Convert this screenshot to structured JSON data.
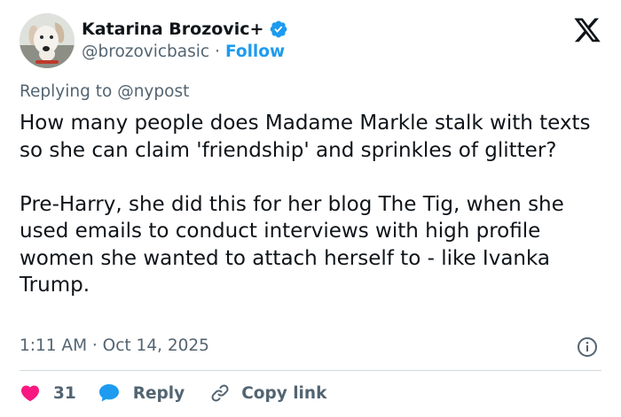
{
  "author": {
    "name": "Katarina Brozovic+",
    "handle": "@brozovicbasic",
    "separator": "·",
    "follow_label": "Follow"
  },
  "reply_context": {
    "prefix": "Replying to",
    "mention": "@nypost"
  },
  "tweet": {
    "text": "How many people does Madame Markle stalk with texts so she can claim 'friendship' and sprinkles of glitter?\n\nPre-Harry, she did this for her blog The Tig, when she used emails to conduct interviews with high profile women she wanted to attach herself to - like Ivanka Trump.",
    "timestamp": "1:11 AM · Oct 14, 2025"
  },
  "actions": {
    "like_count": "31",
    "reply_label": "Reply",
    "copy_link_label": "Copy link"
  },
  "colors": {
    "accent": "#1d9bf0",
    "like": "#f91880",
    "muted": "#536471",
    "text": "#0f1419"
  },
  "icons": [
    "verified-badge-icon",
    "x-logo-icon",
    "info-icon",
    "heart-icon",
    "reply-bubble-icon",
    "link-icon"
  ]
}
